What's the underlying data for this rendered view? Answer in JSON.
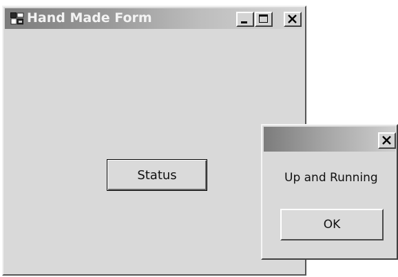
{
  "main_window": {
    "title": "Hand Made Form",
    "status_button_label": "Status",
    "caption_buttons": [
      "minimize-icon",
      "maximize-icon",
      "close-icon"
    ]
  },
  "message_box": {
    "message": "Up and Running",
    "ok_label": "OK",
    "caption_buttons": [
      "close-icon"
    ]
  },
  "colors": {
    "window_face": "#d9d9d9",
    "titlebar_dark": "#7c7c7c",
    "titlebar_light": "#d6d6d6",
    "title_text": "#f3f3f3"
  }
}
